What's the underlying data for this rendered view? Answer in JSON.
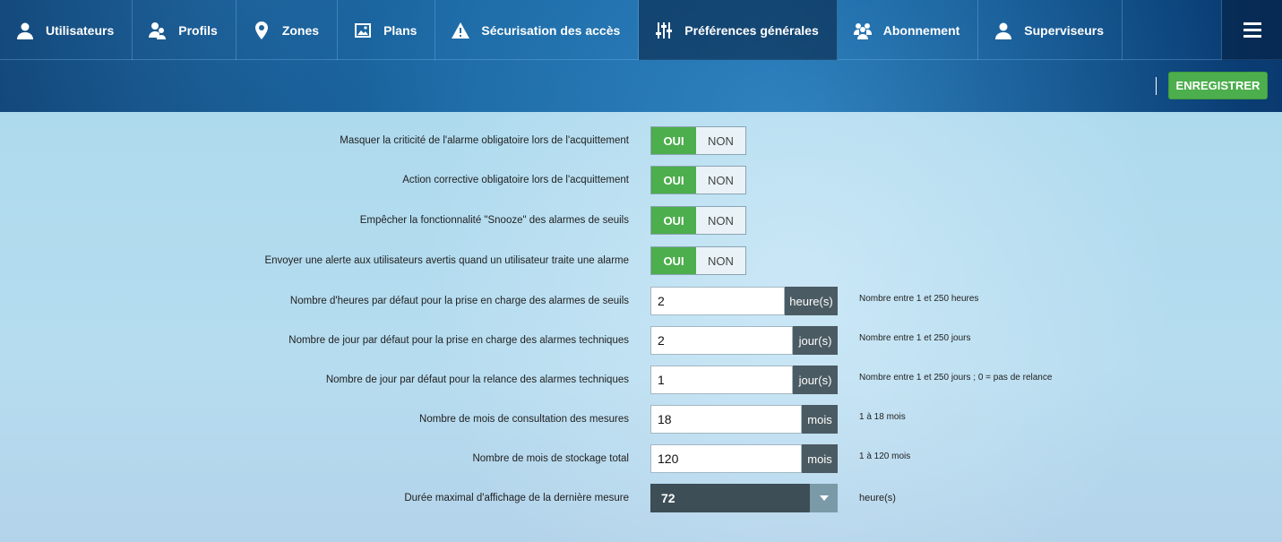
{
  "nav": {
    "items": [
      {
        "label": "Utilisateurs",
        "icon": "user-icon"
      },
      {
        "label": "Profils",
        "icon": "profiles-icon"
      },
      {
        "label": "Zones",
        "icon": "map-pin-icon"
      },
      {
        "label": "Plans",
        "icon": "image-icon"
      },
      {
        "label": "Sécurisation des accès",
        "icon": "warning-icon"
      },
      {
        "label": "Préférences générales",
        "icon": "sliders-icon",
        "active": true
      },
      {
        "label": "Abonnement",
        "icon": "group-icon"
      },
      {
        "label": "Superviseurs",
        "icon": "supervisor-icon"
      }
    ],
    "menu_icon": "hamburger-icon"
  },
  "toolbar": {
    "save_label": "ENREGISTRER",
    "accent": "#4cae4c"
  },
  "settings": {
    "toggles": [
      {
        "label": "Masquer la criticité de l'alarme obligatoire lors de l'acquittement",
        "on": "OUI",
        "off": "NON",
        "value": "OUI"
      },
      {
        "label": "Action corrective obligatoire lors de l'acquittement",
        "on": "OUI",
        "off": "NON",
        "value": "OUI"
      },
      {
        "label": "Empêcher la fonctionnalité \"Snooze\" des alarmes de seuils",
        "on": "OUI",
        "off": "NON",
        "value": "OUI"
      },
      {
        "label": "Envoyer une alerte aux utilisateurs avertis quand un utilisateur traite une alarme",
        "on": "OUI",
        "off": "NON",
        "value": "OUI"
      }
    ],
    "fields": [
      {
        "label": "Nombre d'heures par défaut pour la prise en charge des alarmes de seuils",
        "value": "2",
        "unit": "heure(s)",
        "hint": "Nombre entre 1 et 250 heures"
      },
      {
        "label": "Nombre de jour par défaut pour la prise en charge des alarmes techniques",
        "value": "2",
        "unit": "jour(s)",
        "hint": "Nombre entre 1 et 250 jours"
      },
      {
        "label": "Nombre de jour par défaut pour la relance des alarmes techniques",
        "value": "1",
        "unit": "jour(s)",
        "hint": "Nombre entre 1 et 250 jours ; 0 = pas de relance"
      },
      {
        "label": "Nombre de mois de consultation des mesures",
        "value": "18",
        "unit": "mois",
        "hint": "1 à 18 mois"
      },
      {
        "label": "Nombre de mois de stockage total",
        "value": "120",
        "unit": "mois",
        "hint": "1 à 120 mois"
      }
    ],
    "select": {
      "label": "Durée maximal d'affichage de la dernière mesure",
      "value": "72",
      "unit": "heure(s)"
    }
  }
}
